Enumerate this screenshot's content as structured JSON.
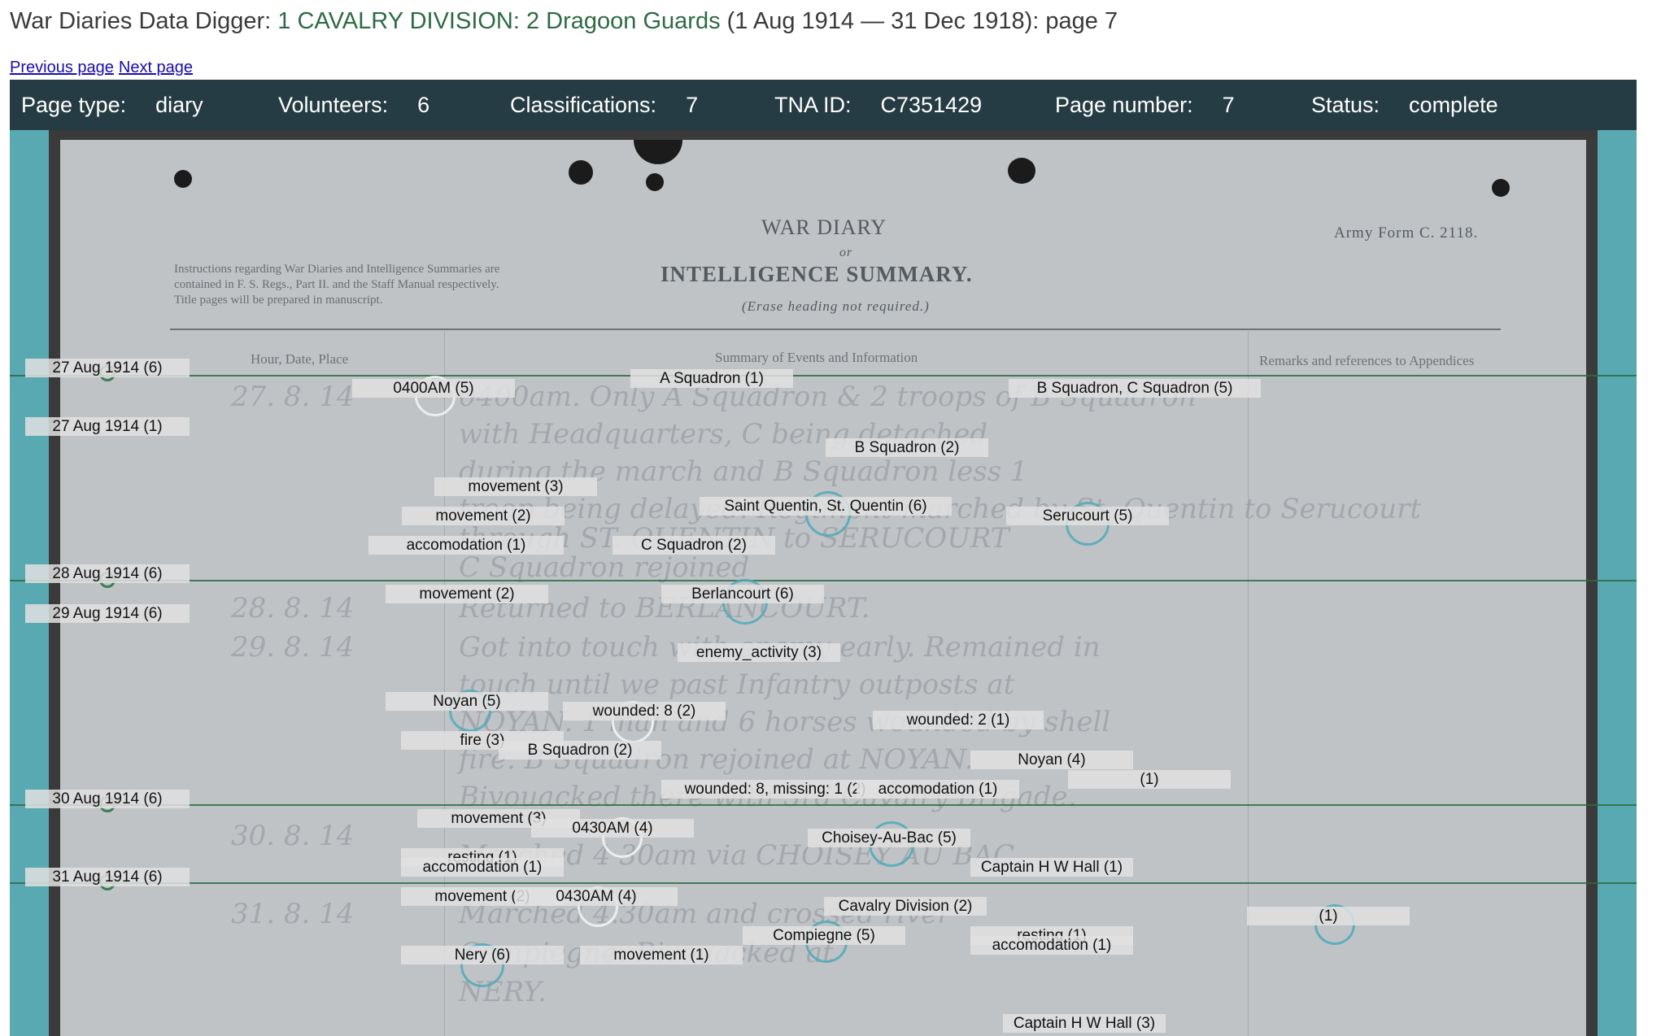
{
  "header": {
    "prefix": "War Diaries Data Digger: ",
    "unit": "1 CAVALRY DIVISION: 2 Dragoon Guards",
    "suffix": " (1 Aug 1914 — 31 Dec 1918): page 7"
  },
  "nav": {
    "previous": "Previous page",
    "next": "Next page"
  },
  "info": {
    "page_type_label": "Page type:",
    "page_type": "diary",
    "volunteers_label": "Volunteers:",
    "volunteers": "6",
    "classifications_label": "Classifications:",
    "classifications": "7",
    "tna_label": "TNA ID:",
    "tna": "C7351429",
    "page_number_label": "Page number:",
    "page_number": "7",
    "status_label": "Status:",
    "status": "complete"
  },
  "document": {
    "title": "WAR DIARY",
    "or": "or",
    "subtitle": "INTELLIGENCE SUMMARY.",
    "erase": "(Erase heading not required.)",
    "army_form": "Army Form C. 2118.",
    "instructions": "Instructions regarding War Diaries and Intelligence Summaries are contained in F. S. Regs., Part II. and the Staff Manual respectively. Title pages will be prepared in manuscript.",
    "col_hour": "Hour, Date, Place",
    "col_summary": "Summary of Events and Information",
    "col_remarks": "Remarks and references to Appendices",
    "handwriting": [
      "27. 8. 14",
      "0400am. Only A Squadron & 2 troops of B Squadron",
      "with Headquarters, C being detached",
      "during the march and B Squadron less 1",
      "troop being delayed. Regiment marched by St. Quentin to Serucourt",
      "through ST. QUENTIN to SERUCOURT",
      "C Squadron rejoined",
      "28. 8. 14",
      "Returned to BERLANCOURT.",
      "29. 8. 14",
      "Got into touch with enemy early. Remained in",
      "touch until we past Infantry outposts at",
      "NOYAN. 1 man and 6 horses wounded by shell",
      "fire. B Squadron rejoined at NOYAN.",
      "Bivouacked there with 3rd Cavalry Brigade.",
      "30. 8. 14",
      "Marched 4 30am via CHOISEY AU BAC.",
      "31. 8. 14",
      "Marched 4.30am and crossed river",
      "Compiegne. Bivouacked at",
      "NERY."
    ]
  },
  "dates": [
    "27 Aug 1914 (6)",
    "27 Aug 1914 (1)",
    "28 Aug 1914 (6)",
    "29 Aug 1914 (6)",
    "30 Aug 1914 (6)",
    "31 Aug 1914 (6)"
  ],
  "tags": [
    "0400AM (5)",
    "A Squadron (1)",
    "B Squadron, C Squadron (5)",
    "B Squadron (2)",
    "movement (3)",
    "Saint Quentin, St. Quentin (6)",
    "movement (2)",
    "Serucourt (5)",
    "accomodation (1)",
    "C Squadron (2)",
    "movement (2)",
    "Berlancourt (6)",
    "enemy_activity (3)",
    "Noyan (5)",
    "wounded: 8 (2)",
    "wounded: 2 (1)",
    "fire (3)",
    "B Squadron (2)",
    "Noyan (4)",
    "(1)",
    "wounded: 8, missing: 1 (2)",
    "accomodation (1)",
    "movement (3)",
    "0430AM (4)",
    "Choisey-Au-Bac (5)",
    "resting (1)",
    "accomodation (1)",
    "Captain H W Hall (1)",
    "movement (2)",
    "0430AM (4)",
    "Cavalry Division (2)",
    "(1)",
    "Compiegne (5)",
    "resting (1)",
    "accomodation (1)",
    "Nery (6)",
    "movement (1)",
    "Captain H W Hall (3)"
  ]
}
